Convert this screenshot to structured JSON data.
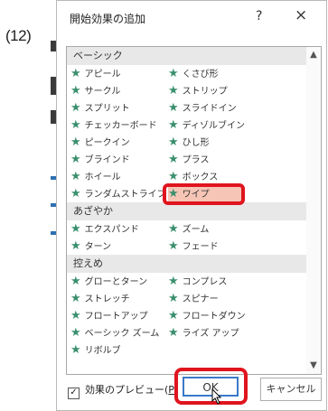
{
  "step_label": "(12)",
  "dialog": {
    "title": "開始効果の追加",
    "help_label": "?",
    "close_label": "×"
  },
  "groups": [
    {
      "label": "ベーシック",
      "rows": [
        [
          "アピール",
          "くさび形"
        ],
        [
          "サークル",
          "ストリップ"
        ],
        [
          "スプリット",
          "スライドイン"
        ],
        [
          "チェッカーボード",
          "ディゾルブイン"
        ],
        [
          "ピークイン",
          "ひし形"
        ],
        [
          "ブラインド",
          "プラス"
        ],
        [
          "ホイール",
          "ボックス"
        ],
        [
          "ランダムストライプ",
          "ワイプ"
        ]
      ]
    },
    {
      "label": "あざやか",
      "rows": [
        [
          "エクスパンド",
          "ズーム"
        ],
        [
          "ターン",
          "フェード"
        ]
      ]
    },
    {
      "label": "控えめ",
      "rows": [
        [
          "グローとターン",
          "コンプレス"
        ],
        [
          "ストレッチ",
          "スピナー"
        ],
        [
          "フロートアップ",
          "フロートダウン"
        ],
        [
          "ベーシック ズーム",
          "ライズ アップ"
        ],
        [
          "リボルブ",
          ""
        ]
      ]
    }
  ],
  "selected_effect": "ワイプ",
  "preview": {
    "label_prefix": "効果のプレビュー(",
    "label_key": "P",
    "label_suffix": ")",
    "checked": true,
    "check_mark": "✓"
  },
  "ok_label": "OK",
  "cancel_label": "キャンセル",
  "icons": {
    "effect": "star-icon",
    "scroll_up": "▲",
    "scroll_down": "▼"
  },
  "colors": {
    "highlight": "#e0141e",
    "star": "#3a8f6e",
    "selection": "#f6c5b6",
    "ok_border": "#3a79c8"
  }
}
